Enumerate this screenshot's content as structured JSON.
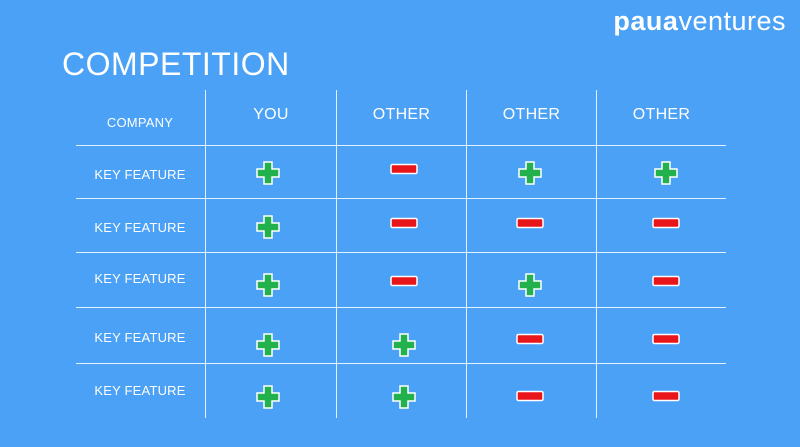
{
  "logo": {
    "bold": "paua",
    "light": "ventures"
  },
  "title": "COMPETITION",
  "table": {
    "corner": "COMPANY",
    "columns": [
      "YOU",
      "OTHER",
      "OTHER",
      "OTHER"
    ],
    "rows": [
      {
        "label": "KEY FEATURE",
        "marks": [
          "plus",
          "minus",
          "plus",
          "plus"
        ]
      },
      {
        "label": "KEY FEATURE",
        "marks": [
          "plus",
          "minus",
          "minus",
          "minus"
        ]
      },
      {
        "label": "KEY FEATURE",
        "marks": [
          "plus",
          "minus",
          "plus",
          "minus"
        ]
      },
      {
        "label": "KEY FEATURE",
        "marks": [
          "plus",
          "plus",
          "minus",
          "minus"
        ]
      },
      {
        "label": "KEY FEATURE",
        "marks": [
          "plus",
          "plus",
          "minus",
          "minus"
        ]
      }
    ]
  },
  "colors": {
    "background": "#4aa1f5",
    "plus": "#22b14c",
    "minus": "#e8151b"
  }
}
